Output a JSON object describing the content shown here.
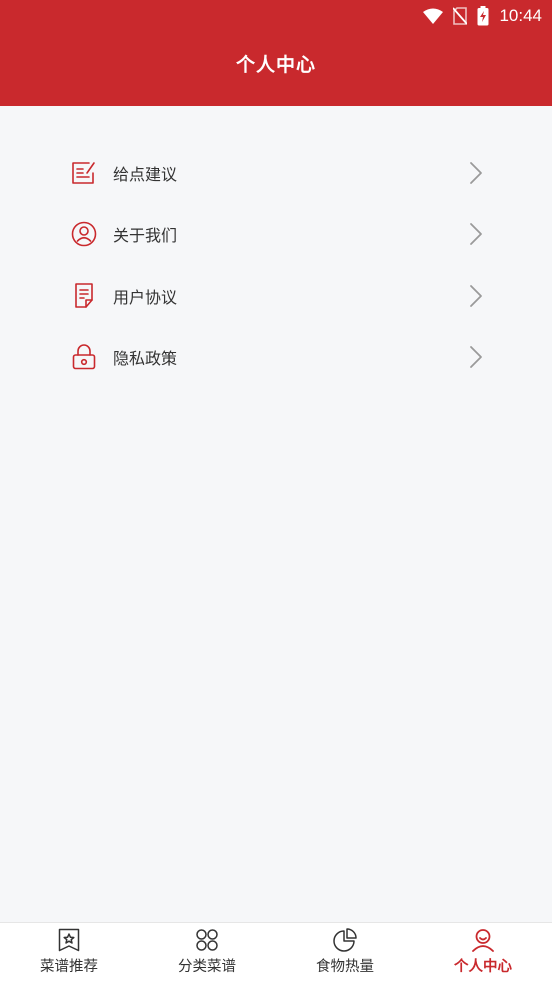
{
  "status_bar": {
    "time": "10:44",
    "icons": [
      "wifi-icon",
      "no-sim-icon",
      "battery-charging-icon"
    ]
  },
  "header": {
    "title": "个人中心"
  },
  "colors": {
    "primary": "#c9292d",
    "background": "#f6f7f9",
    "text": "#333333",
    "arrow": "#9a9a9a"
  },
  "menu": {
    "items": [
      {
        "label": "给点建议",
        "icon": "feedback-icon"
      },
      {
        "label": "关于我们",
        "icon": "user-circle-icon"
      },
      {
        "label": "用户协议",
        "icon": "document-icon"
      },
      {
        "label": "隐私政策",
        "icon": "lock-icon"
      }
    ]
  },
  "tabbar": {
    "tabs": [
      {
        "label": "菜谱推荐",
        "icon": "bookmark-star-icon",
        "active": false
      },
      {
        "label": "分类菜谱",
        "icon": "grid-icon",
        "active": false
      },
      {
        "label": "食物热量",
        "icon": "pie-chart-icon",
        "active": false
      },
      {
        "label": "个人中心",
        "icon": "person-icon",
        "active": true
      }
    ]
  }
}
